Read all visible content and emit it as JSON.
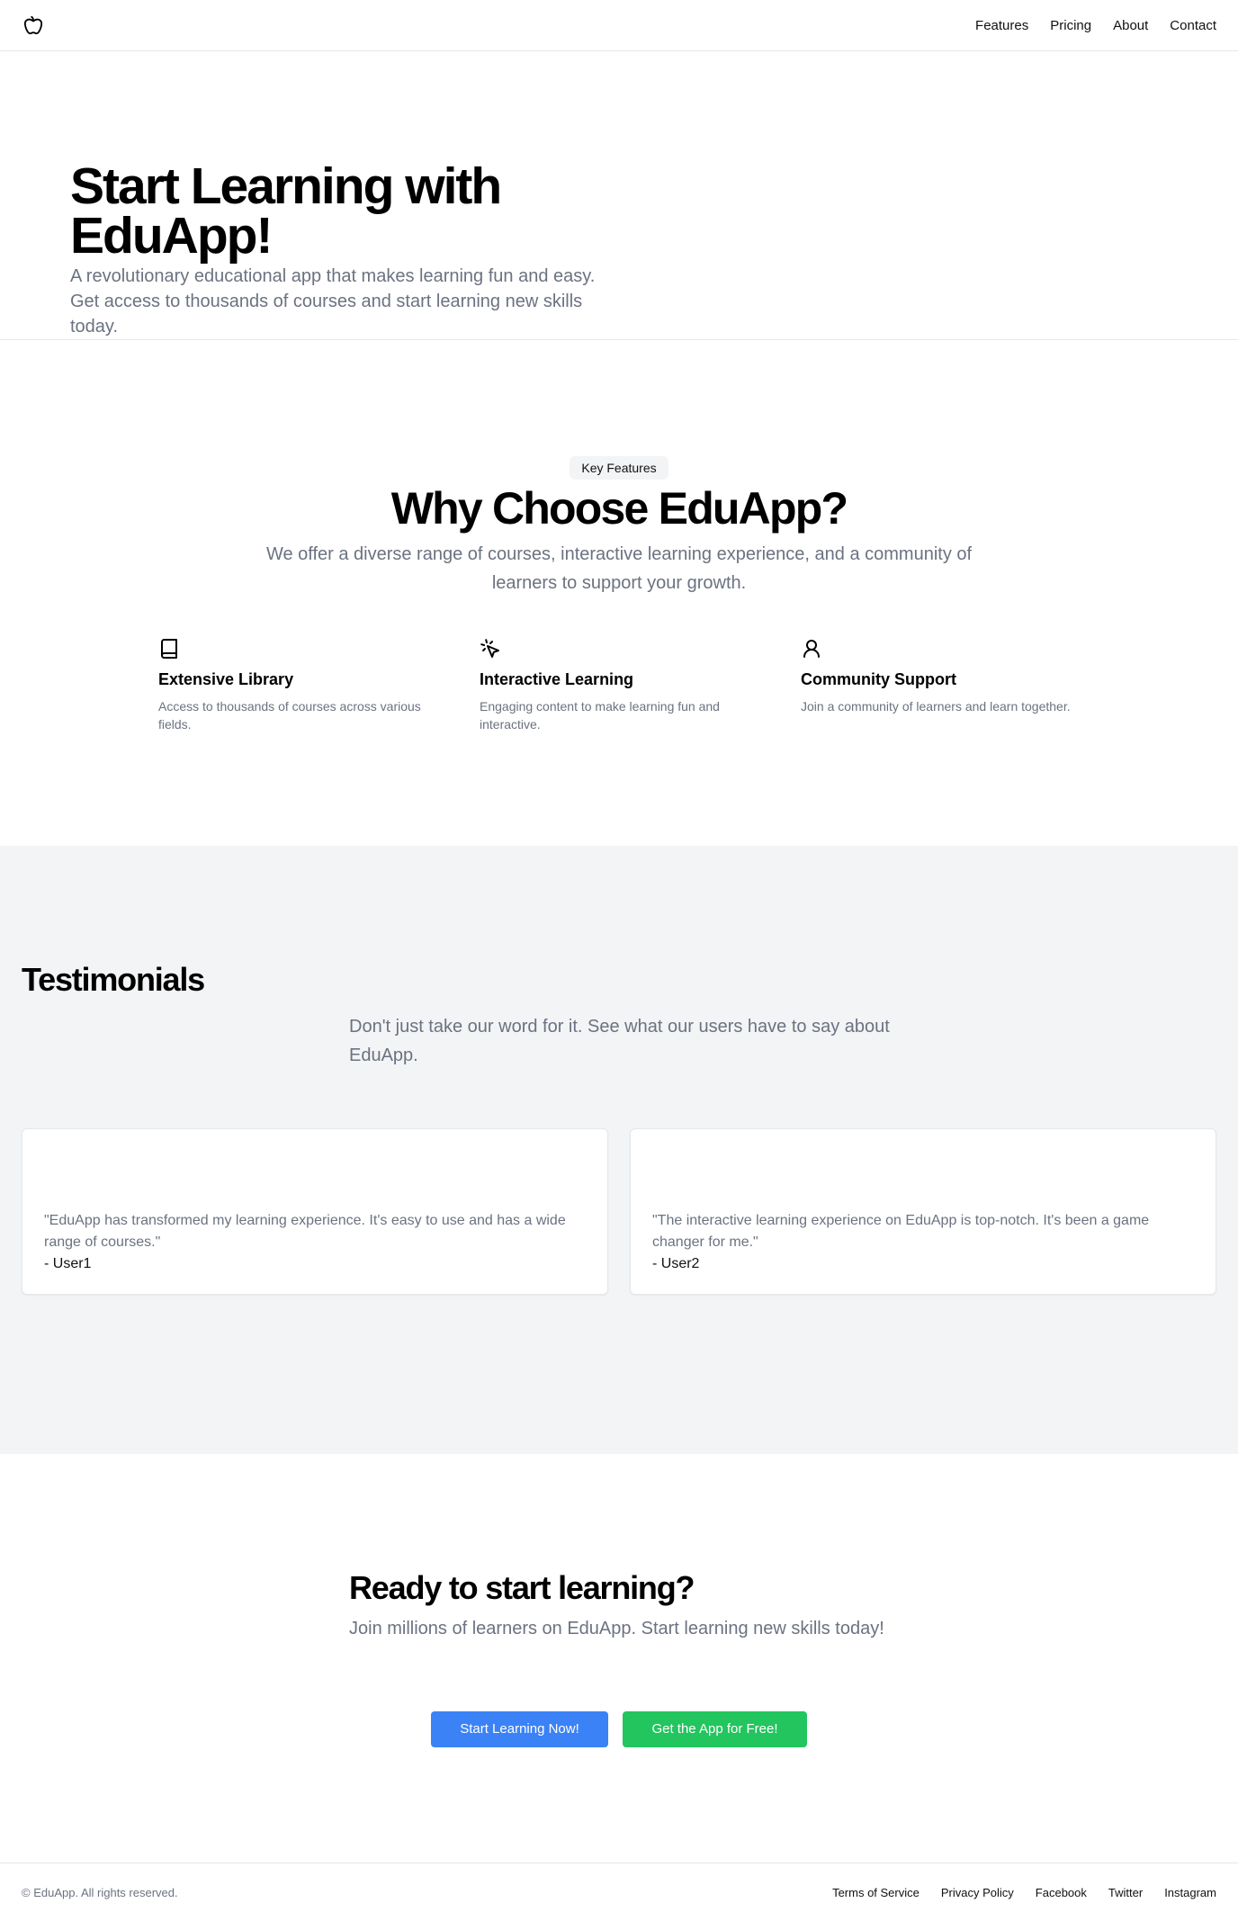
{
  "header": {
    "logo_icon": "apple-icon",
    "nav": [
      {
        "label": "Features"
      },
      {
        "label": "Pricing"
      },
      {
        "label": "About"
      },
      {
        "label": "Contact"
      }
    ]
  },
  "hero": {
    "title": "Start Learning with EduApp!",
    "subtitle": "A revolutionary educational app that makes learning fun and easy. Get access to thousands of courses and start learning new skills today."
  },
  "features": {
    "badge": "Key Features",
    "title": "Why Choose EduApp?",
    "lead": "We offer a diverse range of courses, interactive learning experience, and a community of learners to support your growth.",
    "items": [
      {
        "icon": "book-icon",
        "title": "Extensive Library",
        "text": "Access to thousands of courses across various fields."
      },
      {
        "icon": "pointer-click-icon",
        "title": "Interactive Learning",
        "text": "Engaging content to make learning fun and interactive."
      },
      {
        "icon": "user-icon",
        "title": "Community Support",
        "text": "Join a community of learners and learn together."
      }
    ]
  },
  "testimonials": {
    "title": "Testimonials",
    "lead": "Don't just take our word for it. See what our users have to say about EduApp.",
    "items": [
      {
        "quote": "\"EduApp has transformed my learning experience. It's easy to use and has a wide range of courses.\"",
        "author": "- User1"
      },
      {
        "quote": "\"The interactive learning experience on EduApp is top-notch. It's been a game changer for me.\"",
        "author": "- User2"
      }
    ]
  },
  "cta": {
    "title": "Ready to start learning?",
    "lead": "Join millions of learners on EduApp. Start learning new skills today!",
    "primary_button": "Start Learning Now!",
    "secondary_button": "Get the App for Free!",
    "colors": {
      "primary": "#3b82f6",
      "secondary": "#22c55e"
    }
  },
  "footer": {
    "copyright": "© EduApp. All rights reserved.",
    "links": [
      {
        "label": "Terms of Service"
      },
      {
        "label": "Privacy Policy"
      },
      {
        "label": "Facebook"
      },
      {
        "label": "Twitter"
      },
      {
        "label": "Instagram"
      }
    ]
  }
}
